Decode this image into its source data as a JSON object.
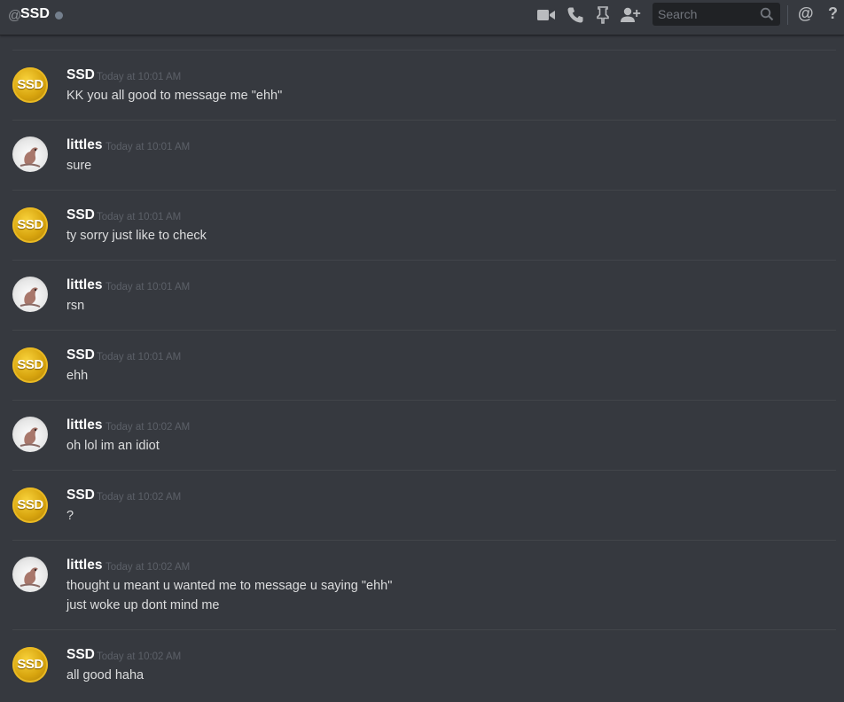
{
  "header": {
    "at_symbol": "@",
    "channel_name": "SSD",
    "search_placeholder": "Search",
    "mention_symbol": "@",
    "help_symbol": "?",
    "icons": [
      "video-call-icon",
      "voice-call-icon",
      "pin-icon",
      "add-friend-icon",
      "search-icon"
    ]
  },
  "colors": {
    "background": "#36393f",
    "author": "#ffffff",
    "timestamp": "#5c6068",
    "content": "#dcddde",
    "ssd_avatar": "#e2ae14"
  },
  "messages": [
    {
      "author": "SSD",
      "timestamp": "Today at 10:01 AM",
      "lines": [
        "KK you all good to message me \"ehh\""
      ],
      "avatar": "ssd",
      "avatar_text": "SSD"
    },
    {
      "author": "littles",
      "timestamp": "Today at 10:01 AM",
      "lines": [
        "sure"
      ],
      "avatar": "littles"
    },
    {
      "author": "SSD",
      "timestamp": "Today at 10:01 AM",
      "lines": [
        "ty sorry just like to check"
      ],
      "avatar": "ssd",
      "avatar_text": "SSD"
    },
    {
      "author": "littles",
      "timestamp": "Today at 10:01 AM",
      "lines": [
        "rsn"
      ],
      "avatar": "littles"
    },
    {
      "author": "SSD",
      "timestamp": "Today at 10:01 AM",
      "lines": [
        "ehh"
      ],
      "avatar": "ssd",
      "avatar_text": "SSD"
    },
    {
      "author": "littles",
      "timestamp": "Today at 10:02 AM",
      "lines": [
        "oh lol im an idiot"
      ],
      "avatar": "littles"
    },
    {
      "author": "SSD",
      "timestamp": "Today at 10:02 AM",
      "lines": [
        "?"
      ],
      "avatar": "ssd",
      "avatar_text": "SSD"
    },
    {
      "author": "littles",
      "timestamp": "Today at 10:02 AM",
      "lines": [
        "thought u meant u wanted me to message u saying \"ehh\"",
        "just woke up dont mind me"
      ],
      "avatar": "littles"
    },
    {
      "author": "SSD",
      "timestamp": "Today at 10:02 AM",
      "lines": [
        "all good haha"
      ],
      "avatar": "ssd",
      "avatar_text": "SSD"
    }
  ]
}
